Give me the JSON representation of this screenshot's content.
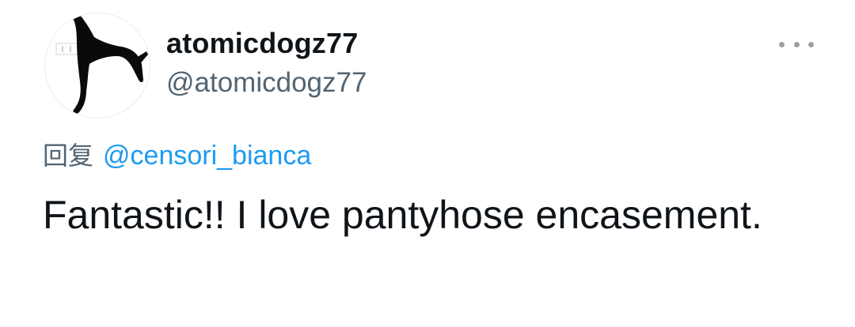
{
  "tweet": {
    "author": {
      "display_name": "atomicdogz77",
      "handle": "@atomicdogz77",
      "avatar_icon": "boot-silhouette-icon"
    },
    "more_icon": "more-horizontal-icon",
    "reply": {
      "prefix": "回复",
      "mention": "@censori_bianca"
    },
    "text": "Fantastic!! I love pantyhose encasement."
  },
  "colors": {
    "name": "#0f1419",
    "handle": "#536471",
    "mention": "#1d9bf0",
    "text": "#0f1419"
  }
}
